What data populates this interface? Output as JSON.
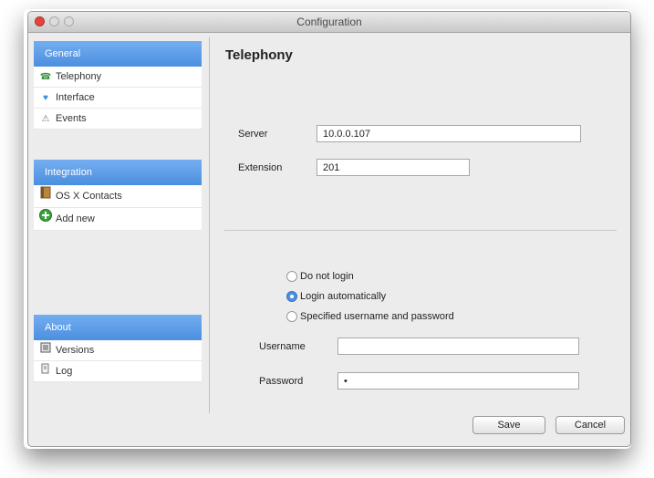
{
  "window": {
    "title": "Configuration"
  },
  "sidebar": {
    "general": {
      "header": "General",
      "items": [
        {
          "label": "Telephony",
          "icon": "phone-icon"
        },
        {
          "label": "Interface",
          "icon": "palette-icon"
        },
        {
          "label": "Events",
          "icon": "events-icon"
        }
      ]
    },
    "integration": {
      "header": "Integration",
      "items": [
        {
          "label": "OS X Contacts",
          "icon": "address-book-icon"
        },
        {
          "label": "Add new",
          "icon": "plus-circle-icon"
        }
      ]
    },
    "about": {
      "header": "About",
      "items": [
        {
          "label": "Versions",
          "icon": "document-icon"
        },
        {
          "label": "Log",
          "icon": "log-icon"
        }
      ]
    }
  },
  "content": {
    "title": "Telephony",
    "server": {
      "label": "Server",
      "value": "10.0.0.107"
    },
    "extension": {
      "label": "Extension",
      "value": "201"
    },
    "login_options": [
      {
        "label": "Do not login",
        "selected": false
      },
      {
        "label": "Login automatically",
        "selected": true
      },
      {
        "label": "Specified username and password",
        "selected": false
      }
    ],
    "username": {
      "label": "Username",
      "value": ""
    },
    "password": {
      "label": "Password",
      "value": "•"
    }
  },
  "footer": {
    "save_label": "Save",
    "cancel_label": "Cancel"
  }
}
